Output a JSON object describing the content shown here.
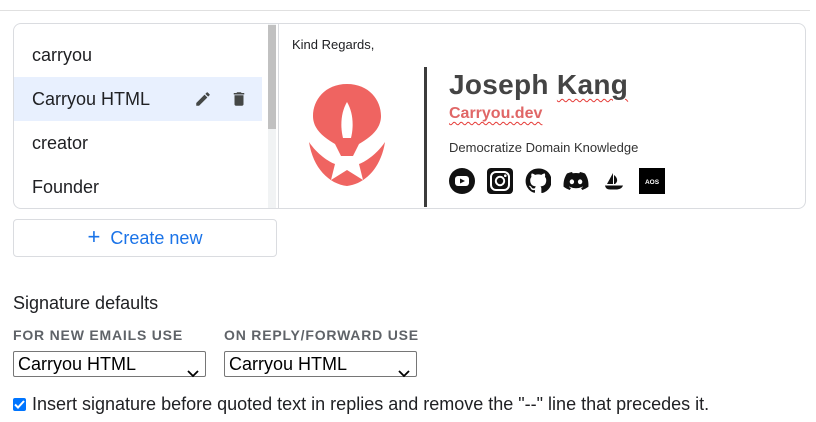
{
  "signatures": {
    "items": [
      {
        "label": "carryou"
      },
      {
        "label": "Carryou HTML",
        "selected": true
      },
      {
        "label": "creator"
      },
      {
        "label": "Founder"
      }
    ],
    "edit_icon": "pencil-icon",
    "delete_icon": "trash-icon"
  },
  "preview": {
    "regards": "Kind Regards,",
    "name": "Joseph Kang",
    "name_first": "Joseph ",
    "name_last": "Kang",
    "website": "Carryou.dev",
    "tagline": "Democratize Domain Knowledge",
    "logo_color": "#ef6461",
    "socials": [
      "youtube-icon",
      "instagram-icon",
      "github-icon",
      "discord-icon",
      "opensea-icon",
      "aos-icon"
    ],
    "aos_text": "AOS"
  },
  "create_button": {
    "label": "Create new"
  },
  "defaults": {
    "title": "Signature defaults",
    "new_emails_label": "FOR NEW EMAILS USE",
    "new_emails_value": "Carryou HTML",
    "reply_label": "ON REPLY/FORWARD USE",
    "reply_value": "Carryou HTML"
  },
  "insert_option": {
    "checked": true,
    "label": "Insert signature before quoted text in replies and remove the \"--\" line that precedes it."
  },
  "colors": {
    "accent": "#1a73e8",
    "selected_bg": "#e8f0fe",
    "brand": "#ef6461",
    "checkbox": "#0075ff"
  }
}
